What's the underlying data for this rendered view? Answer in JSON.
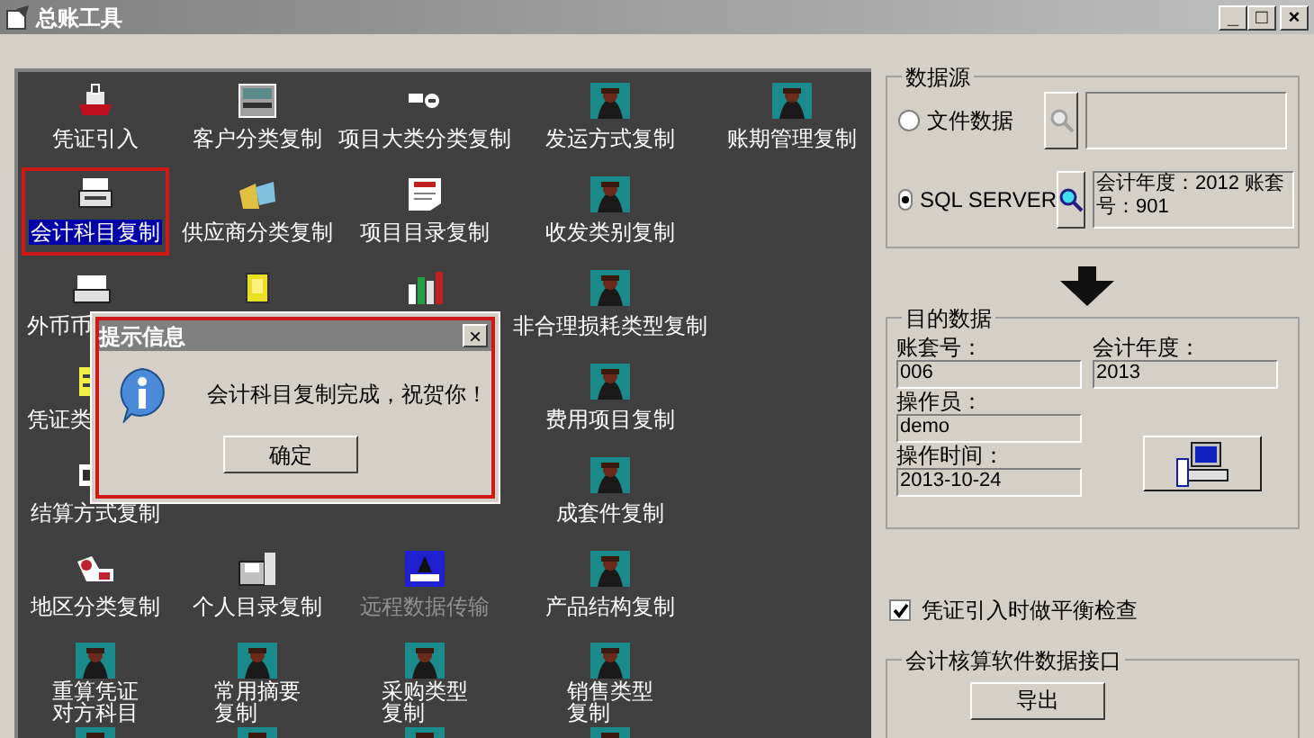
{
  "window": {
    "title": "总账工具",
    "controls": [
      "_",
      "□",
      "×"
    ]
  },
  "tools": [
    [
      {
        "kind": "stamp",
        "label": "凭证引入",
        "selected": false,
        "disabled": false
      },
      {
        "kind": "cabinet",
        "label": "客户分类复制",
        "selected": false,
        "disabled": false
      },
      {
        "kind": "arrows",
        "label": "项目大类分类复制",
        "selected": false,
        "disabled": false
      },
      {
        "kind": "figure",
        "label": "发运方式复制",
        "selected": false,
        "disabled": false
      },
      {
        "kind": "figure",
        "label": "账期管理复制",
        "selected": false,
        "disabled": false
      }
    ],
    [
      {
        "kind": "printer",
        "label": "会计科目复制",
        "selected": true,
        "disabled": false
      },
      {
        "kind": "folders",
        "label": "供应商分类复制",
        "selected": false,
        "disabled": false
      },
      {
        "kind": "document",
        "label": "项目目录复制",
        "selected": false,
        "disabled": false
      },
      {
        "kind": "figure",
        "label": "收发类别复制",
        "selected": false,
        "disabled": false
      }
    ],
    [
      {
        "kind": "tray",
        "label": "外币币",
        "covered": true,
        "selected": false,
        "disabled": false
      },
      {
        "kind": "files"
      },
      {
        "kind": "chart"
      },
      {
        "kind": "figure",
        "label": "非合理损耗类型复制",
        "selected": false,
        "disabled": false
      }
    ],
    [
      {
        "kind": "note",
        "label": "凭证类",
        "covered": true,
        "selected": false,
        "disabled": false
      },
      {
        "kind": "hidden"
      },
      {
        "kind": "hidden"
      },
      {
        "kind": "figure",
        "label": "费用项目复制",
        "selected": false,
        "disabled": false
      }
    ],
    [
      {
        "kind": "card",
        "label": "结算方式复制",
        "selected": false,
        "disabled": false
      },
      {
        "kind": "hidden"
      },
      {
        "kind": "hidden"
      },
      {
        "kind": "figure",
        "label": "成套件复制",
        "selected": false,
        "disabled": false
      }
    ],
    [
      {
        "kind": "car",
        "label": "地区分类复制",
        "selected": false,
        "disabled": false
      },
      {
        "kind": "disk",
        "label": "个人目录复制",
        "selected": false,
        "disabled": false
      },
      {
        "kind": "monitor",
        "label": "远程数据传输",
        "selected": false,
        "disabled": true
      },
      {
        "kind": "figure",
        "label": "产品结构复制",
        "selected": false,
        "disabled": false
      }
    ],
    [
      {
        "kind": "figure",
        "lines": [
          "重算凭证",
          "对方科目"
        ],
        "selected": false,
        "disabled": false
      },
      {
        "kind": "figure",
        "lines": [
          "常用摘要",
          "复制"
        ],
        "selected": false,
        "disabled": false
      },
      {
        "kind": "figure",
        "lines": [
          "采购类型",
          "复制"
        ],
        "selected": false,
        "disabled": false
      },
      {
        "kind": "figure",
        "lines": [
          "销售类型",
          "复制"
        ],
        "selected": false,
        "disabled": false
      }
    ],
    [
      {
        "kind": "figure"
      },
      {
        "kind": "figure"
      },
      {
        "kind": "figure"
      },
      {
        "kind": "figure"
      }
    ]
  ],
  "dialog": {
    "title": "提示信息",
    "close": "×",
    "message": "会计科目复制完成，祝贺你！",
    "button": "确定"
  },
  "source": {
    "title": "数据源",
    "options": [
      {
        "label": "文件数据",
        "selected": false
      },
      {
        "label": "SQL SERVER",
        "selected": true,
        "value": "会计年度：2012 账套号：901"
      }
    ]
  },
  "target": {
    "title": "目的数据",
    "fields": [
      {
        "label": "账套号：",
        "value": "006"
      },
      {
        "label": "会计年度：",
        "value": "2013"
      },
      {
        "label": "操作员：",
        "value": "demo"
      },
      {
        "label": "操作时间：",
        "value": "2013-10-24"
      }
    ]
  },
  "balance_check": {
    "label": "凭证引入时做平衡检查",
    "checked": true
  },
  "interface": {
    "title": "会计核算软件数据接口",
    "button": "导出"
  }
}
